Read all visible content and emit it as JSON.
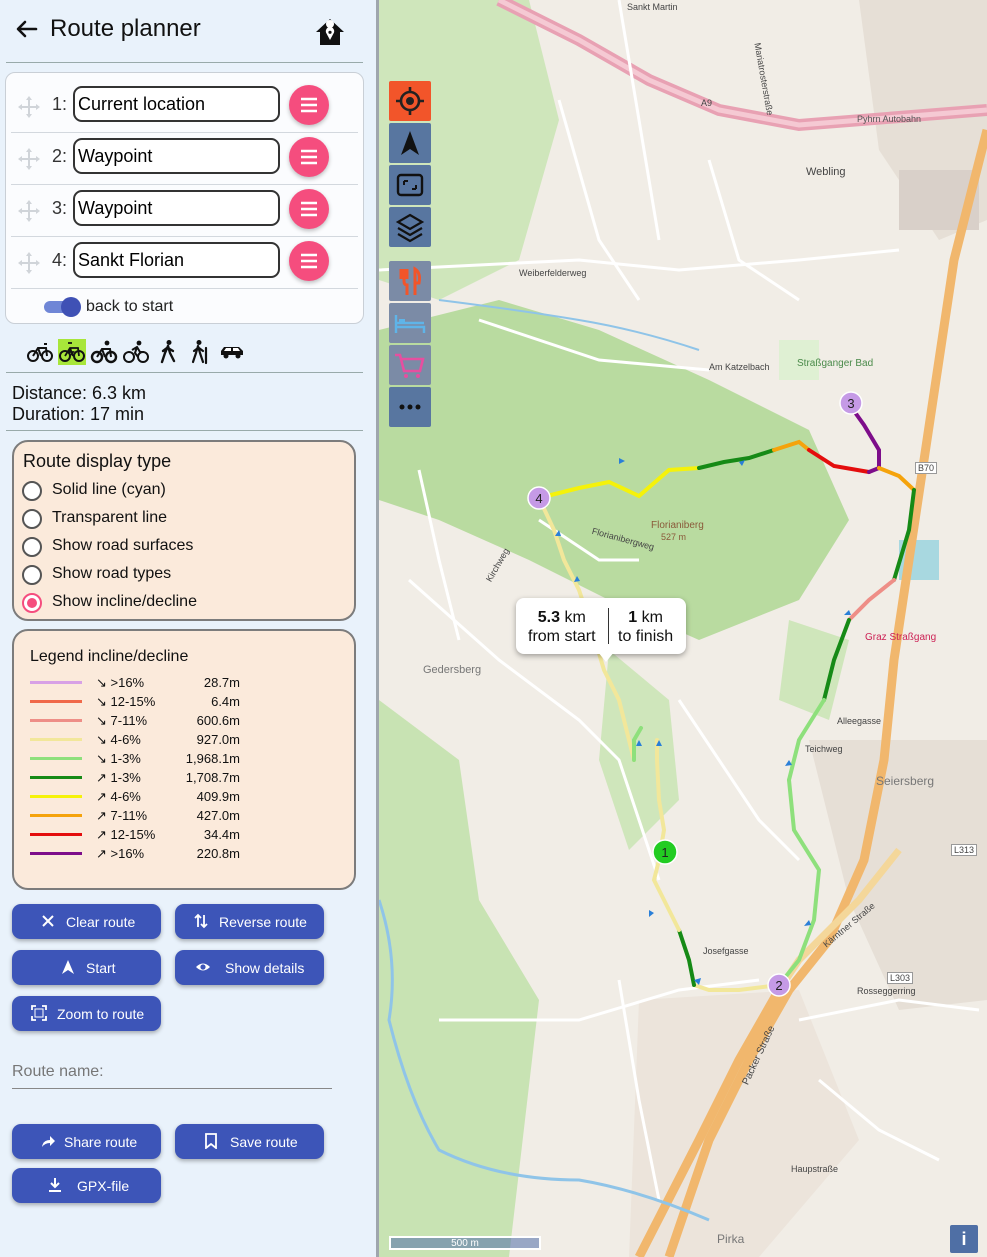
{
  "header": {
    "title": "Route planner"
  },
  "waypoints": [
    {
      "num": "1:",
      "value": "Current location"
    },
    {
      "num": "2:",
      "value": "Waypoint"
    },
    {
      "num": "3:",
      "value": "Waypoint"
    },
    {
      "num": "4:",
      "value": "Sankt Florian"
    }
  ],
  "back_to_start": {
    "label": "back to start",
    "on": true
  },
  "modes": [
    "road-bike-icon",
    "ebike-icon",
    "mountain-bike-icon",
    "cycling-icon",
    "walking-icon",
    "hiking-icon",
    "car-icon"
  ],
  "active_mode": "ebike-icon",
  "stats": {
    "distance": "Distance: 6.3 km",
    "duration": "Duration: 17 min"
  },
  "display_type": {
    "title": "Route display type",
    "options": [
      "Solid line (cyan)",
      "Transparent line",
      "Show road surfaces",
      "Show road types",
      "Show incline/decline"
    ],
    "selected": 4
  },
  "legend": {
    "title": "Legend incline/decline",
    "rows": [
      {
        "label": "↘ >16%",
        "value": "28.7m",
        "color": "#d8a1e6"
      },
      {
        "label": "↘ 12-15%",
        "value": "6.4m",
        "color": "#f0694a"
      },
      {
        "label": "↘ 7-11%",
        "value": "600.6m",
        "color": "#ee8e87"
      },
      {
        "label": "↘ 4-6%",
        "value": "927.0m",
        "color": "#f2e79a"
      },
      {
        "label": "↘ 1-3%",
        "value": "1,968.1m",
        "color": "#8ee07c"
      },
      {
        "label": "↗ 1-3%",
        "value": "1,708.7m",
        "color": "#168a16"
      },
      {
        "label": "↗ 4-6%",
        "value": "409.9m",
        "color": "#f5f20a"
      },
      {
        "label": "↗ 7-11%",
        "value": "427.0m",
        "color": "#f5a30c"
      },
      {
        "label": "↗ 12-15%",
        "value": "34.4m",
        "color": "#e40d0d"
      },
      {
        "label": "↗ >16%",
        "value": "220.8m",
        "color": "#7d0d8a"
      }
    ]
  },
  "buttons": {
    "clear": "Clear route",
    "reverse": "Reverse route",
    "start": "Start",
    "details": "Show details",
    "zoom": "Zoom to route",
    "share": "Share route",
    "save": "Save route",
    "gpx": "GPX-file"
  },
  "route_name": {
    "label": "Route name:"
  },
  "map": {
    "popup": {
      "from_value": "5.3",
      "from_unit": "km",
      "from_label": "from start",
      "to_value": "1",
      "to_unit": "km",
      "to_label": "to finish"
    },
    "scale": "500 m",
    "markers": [
      "1",
      "2",
      "3",
      "4"
    ],
    "labels": [
      "Sankt Martin",
      "Pyhrn Autobahn",
      "A9",
      "Webling",
      "Weiberfelderweg",
      "Am Katzelbach",
      "Straßganger Bad",
      "Florianiberg",
      "527 m",
      "Gedersberg",
      "Seiersberg",
      "B70",
      "L313",
      "L303",
      "Kärntner Straße",
      "Packer Straße",
      "Pirka",
      "Graz Straßgang",
      "Mariatrosterstraße",
      "Florianibergweg",
      "Josefgasse",
      "Rosseggerring",
      "Haupstraße",
      "Kirchweg",
      "Alleegasse",
      "Teichweg"
    ]
  }
}
